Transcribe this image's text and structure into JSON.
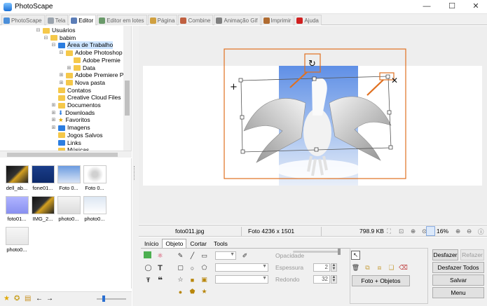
{
  "window": {
    "title": "PhotoScape",
    "minimize": "—",
    "maximize": "☐",
    "close": "✕"
  },
  "tabs": [
    {
      "label": "PhotoScape",
      "icon": "#4c8fd9",
      "active": false
    },
    {
      "label": "Tela",
      "icon": "#9aa3ad",
      "active": false
    },
    {
      "label": "Editor",
      "icon": "#5b7db7",
      "active": true
    },
    {
      "label": "Editor em lotes",
      "icon": "#6a9a6a",
      "active": false
    },
    {
      "label": "Página",
      "icon": "#d0a040",
      "active": false
    },
    {
      "label": "Combine",
      "icon": "#c06040",
      "active": false
    },
    {
      "label": "Animação Gif",
      "icon": "#808080",
      "active": false
    },
    {
      "label": "Imprimir",
      "icon": "#b06b30",
      "active": false
    },
    {
      "label": "Ajuda",
      "icon": "#d02020",
      "active": false
    }
  ],
  "tree": [
    {
      "label": "Usuários",
      "indent": 3,
      "exp": "⊟",
      "icon": "folder",
      "sel": false
    },
    {
      "label": "babim",
      "indent": 4,
      "exp": "⊟",
      "icon": "folder",
      "sel": false
    },
    {
      "label": "Área de Trabalho",
      "indent": 5,
      "exp": "⊟",
      "icon": "folder-blue",
      "sel": true
    },
    {
      "label": "Adobe Photoshop",
      "indent": 6,
      "exp": "⊟",
      "icon": "folder",
      "sel": false
    },
    {
      "label": "Adobe Premie",
      "indent": 7,
      "exp": "",
      "icon": "folder",
      "sel": false
    },
    {
      "label": "Data",
      "indent": 7,
      "exp": "⊞",
      "icon": "folder",
      "sel": false
    },
    {
      "label": "Adobe Premiere P",
      "indent": 6,
      "exp": "⊞",
      "icon": "folder",
      "sel": false
    },
    {
      "label": "Nova pasta",
      "indent": 6,
      "exp": "⊞",
      "icon": "folder",
      "sel": false
    },
    {
      "label": "Contatos",
      "indent": 5,
      "exp": "",
      "icon": "folder",
      "sel": false
    },
    {
      "label": "Creative Cloud Files",
      "indent": 5,
      "exp": "",
      "icon": "folder",
      "sel": false
    },
    {
      "label": "Documentos",
      "indent": 5,
      "exp": "⊞",
      "icon": "folder",
      "sel": false
    },
    {
      "label": "Downloads",
      "indent": 5,
      "exp": "⊞",
      "icon": "download",
      "sel": false
    },
    {
      "label": "Favoritos",
      "indent": 5,
      "exp": "⊞",
      "icon": "star",
      "sel": false
    },
    {
      "label": "Imagens",
      "indent": 5,
      "exp": "⊞",
      "icon": "folder-blue",
      "sel": false
    },
    {
      "label": "Jogos Salvos",
      "indent": 5,
      "exp": "",
      "icon": "folder",
      "sel": false
    },
    {
      "label": "Links",
      "indent": 5,
      "exp": "",
      "icon": "folder-blue",
      "sel": false
    },
    {
      "label": "Músicas",
      "indent": 5,
      "exp": "",
      "icon": "folder",
      "sel": false
    }
  ],
  "thumbs": [
    {
      "name": "dell_ab...",
      "bg": "linear-gradient(135deg,#111 0%,#333 45%,#d4a020 55%,#222 100%)"
    },
    {
      "name": "fone01...",
      "bg": "linear-gradient(#1a3d8a,#0d2a6a)"
    },
    {
      "name": "Foto 0...",
      "bg": "linear-gradient(#6b9be0,#d8e4f5)"
    },
    {
      "name": "Foto 0...",
      "bg": "radial-gradient(circle,#d0d0d0 20%,#fff 60%)"
    },
    {
      "name": "foto01...",
      "bg": "linear-gradient(#b0b4ff,#8890f0)"
    },
    {
      "name": "IMG_2...",
      "bg": "linear-gradient(135deg,#111 0%,#333 45%,#d4a020 55%,#222 100%)"
    },
    {
      "name": "photo0...",
      "bg": "linear-gradient(#f4f4f4,#dcdcdc)"
    },
    {
      "name": "photo0...",
      "bg": "linear-gradient(#dce6f2,#fff)"
    },
    {
      "name": "photo0...",
      "bg": "linear-gradient(#f6f6f6,#e6e6e6)"
    }
  ],
  "info": {
    "filename": "foto011.jpg",
    "dims": "Foto 4236 x 1501",
    "size": "798.9 KB",
    "zoom": "16%"
  },
  "editor": {
    "subtabs": [
      "Início",
      "Objeto",
      "Cortar",
      "Tools"
    ],
    "active_subtab": 1,
    "opacity_label": "Opacidade",
    "thickness_label": "Espessura",
    "thickness_value": "2",
    "rounded_label": "Redondo",
    "rounded_value": "32",
    "photo_objects_button": "Foto + Objetos"
  },
  "actions": {
    "undo": "Desfazer",
    "redo": "Refazer",
    "undo_all": "Desfazer Todos",
    "save": "Salvar",
    "menu": "Menu"
  }
}
